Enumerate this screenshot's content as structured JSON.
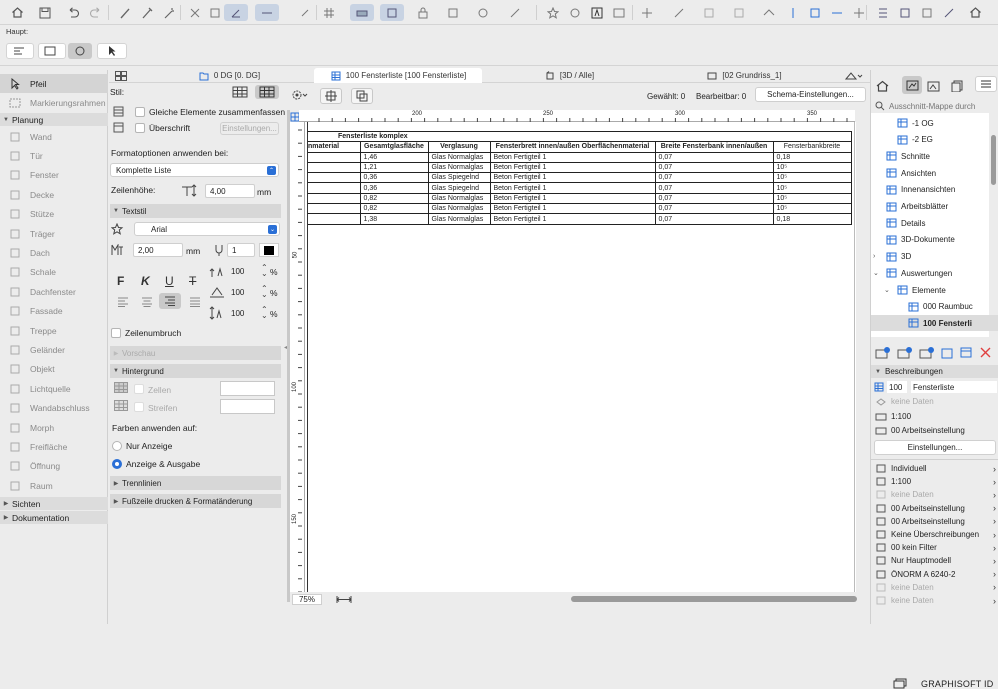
{
  "toolbar": {
    "label": "Haupt:"
  },
  "tabs": [
    {
      "label": "0 DG [0. DG]"
    },
    {
      "label": "100 Fensterliste [100 Fensterliste]"
    },
    {
      "label": "[3D / Alle]"
    },
    {
      "label": "[02 Grundriss_1]"
    }
  ],
  "toolbox": {
    "active_tool": "Pfeil",
    "marquee": "Markierungsrahmen",
    "groups": {
      "planung": "Planung",
      "sichten": "Sichten",
      "dokumentation": "Dokumentation"
    },
    "tools": [
      "Wand",
      "Tür",
      "Fenster",
      "Decke",
      "Stütze",
      "Träger",
      "Dach",
      "Schale",
      "Dachfenster",
      "Fassade",
      "Treppe",
      "Geländer",
      "Objekt",
      "Lichtquelle",
      "Wandabschluss",
      "Morph",
      "Freifläche",
      "Öffnung",
      "Raum"
    ]
  },
  "settings": {
    "stil_label": "Stil:",
    "gleiche": "Gleiche Elemente zusammenfassen",
    "ueberschrift": "Überschrift",
    "einstellungen_btn": "Einstellungen...",
    "format_label": "Formatoptionen anwenden bei:",
    "format_value": "Komplette Liste",
    "zeilenhoehe_label": "Zeilenhöhe:",
    "zeilenhoehe_value": "4,00",
    "unit_mm": "mm",
    "textstil": "Textstil",
    "font": "Arial",
    "size_value": "2,00",
    "pen_value": "1",
    "spacing_values": [
      "100",
      "100",
      "100"
    ],
    "percent": "%",
    "zeilenumbruch": "Zeilenumbruch",
    "vorschau": "Vorschau",
    "hintergrund": "Hintergrund",
    "zellen": "Zellen",
    "streifen": "Streifen",
    "farben_label": "Farben anwenden auf:",
    "nur_anzeige": "Nur Anzeige",
    "anzeige_ausgabe": "Anzeige & Ausgabe",
    "trennlinien": "Trennlinien",
    "fusszeile": "Fußzeile drucken & Formatänderung"
  },
  "viewtb": {
    "gewaehlt": "Gewählt: 0",
    "bearbeitbar": "Bearbeitbar: 0",
    "schema_btn": "Schema-Einstellungen..."
  },
  "ruler": {
    "top": [
      "200",
      "250",
      "300",
      "350"
    ],
    "left": [
      "50",
      "100",
      "150"
    ]
  },
  "schedule": {
    "title": "Fensterliste komplex",
    "headers": [
      "nmaterial",
      "Gesamtglasfläche",
      "Verglasung",
      "Fensterbrett innen/außen Oberflächenmaterial",
      "Breite Fensterbank innen/außen",
      "Fensterbankbreite"
    ],
    "rows": [
      [
        "",
        "1,46",
        "Glas Normalglas",
        "Beton Fertigteil 1",
        "0,07",
        "0,18"
      ],
      [
        "",
        "1,21",
        "Glas Normalglas",
        "Beton Fertigteil 1",
        "0,07",
        "10⁵"
      ],
      [
        "",
        "0,36",
        "Glas Spiegelnd",
        "Beton Fertigteil 1",
        "0,07",
        "10⁵"
      ],
      [
        "",
        "0,36",
        "Glas Spiegelnd",
        "Beton Fertigteil 1",
        "0,07",
        "10⁵"
      ],
      [
        "",
        "0,82",
        "Glas Normalglas",
        "Beton Fertigteil 1",
        "0,07",
        "10⁵"
      ],
      [
        "",
        "0,82",
        "Glas Normalglas",
        "Beton Fertigteil 1",
        "0,07",
        "10⁵"
      ],
      [
        "",
        "1,38",
        "Glas Normalglas",
        "Beton Fertigteil 1",
        "0,07",
        "0,18"
      ]
    ]
  },
  "zoom": "75%",
  "navigator": {
    "search_placeholder": "Ausschnitt-Mappe durch",
    "items": [
      {
        "label": "-1 OG",
        "indent": 3
      },
      {
        "label": "-2 EG",
        "indent": 3
      },
      {
        "label": "Schnitte",
        "indent": 2
      },
      {
        "label": "Ansichten",
        "indent": 2
      },
      {
        "label": "Innenansichten",
        "indent": 2
      },
      {
        "label": "Arbeitsblätter",
        "indent": 2
      },
      {
        "label": "Details",
        "indent": 2
      },
      {
        "label": "3D-Dokumente",
        "indent": 2
      },
      {
        "label": "3D",
        "indent": 2
      },
      {
        "label": "Auswertungen",
        "indent": 2
      },
      {
        "label": "Elemente",
        "indent": 3
      },
      {
        "label": "000 Raumbuc",
        "indent": 4
      },
      {
        "label": "100 Fensterli",
        "indent": 4
      }
    ],
    "beschreibungen": "Beschreibungen",
    "id_value": "100",
    "name_value": "Fensterliste",
    "keine_daten": "keine Daten",
    "scale": "1:100",
    "arbeitseinstellung": "00 Arbeitseinstellung",
    "einstellungen_btn": "Einstellungen...",
    "props": [
      {
        "label": "Individuell",
        "dis": false
      },
      {
        "label": "1:100",
        "dis": false
      },
      {
        "label": "keine Daten",
        "dis": true
      },
      {
        "label": "00 Arbeitseinstellung",
        "dis": false
      },
      {
        "label": "00 Arbeitseinstellung",
        "dis": false
      },
      {
        "label": "Keine Überschreibungen",
        "dis": false
      },
      {
        "label": "00 kein Filter",
        "dis": false
      },
      {
        "label": "Nur Hauptmodell",
        "dis": false
      },
      {
        "label": "ÖNORM A 6240-2",
        "dis": false
      },
      {
        "label": "keine Daten",
        "dis": true
      },
      {
        "label": "keine Daten",
        "dis": true
      }
    ],
    "brand": "GRAPHISOFT ID"
  }
}
